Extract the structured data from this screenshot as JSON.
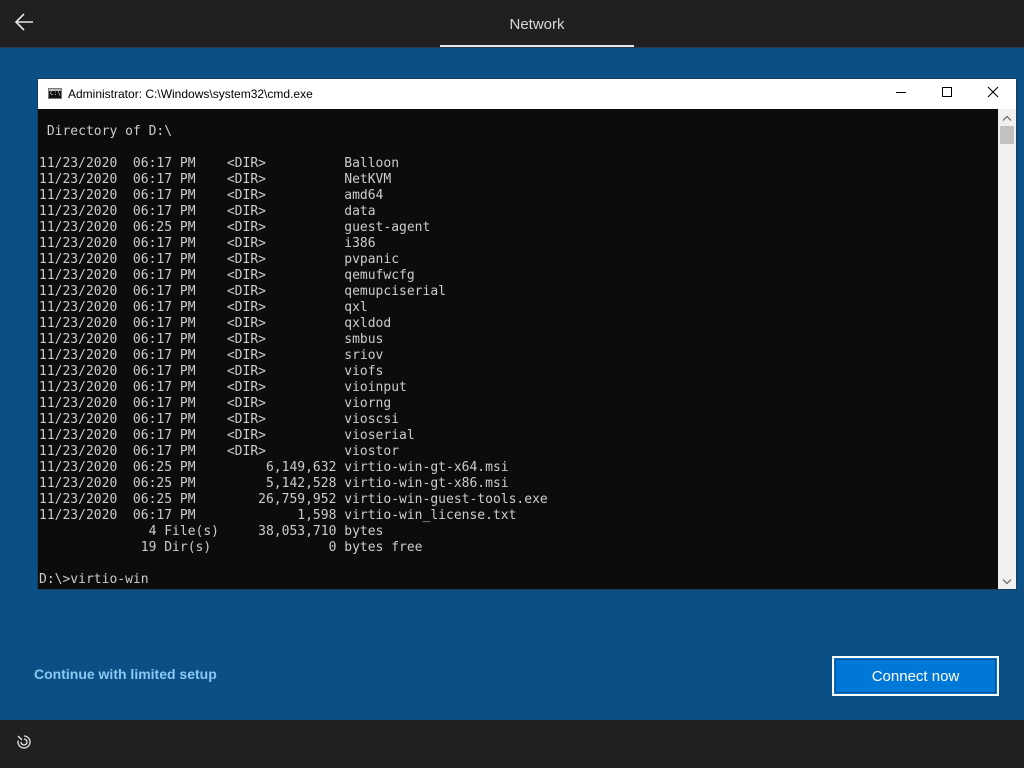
{
  "header": {
    "title": "Network",
    "back_icon": "arrow-left-icon"
  },
  "cmd_window": {
    "title": "Administrator: C:\\Windows\\system32\\cmd.exe",
    "icons": {
      "app": "cmd-app-icon",
      "minimize": "minimize-icon",
      "maximize": "maximize-icon",
      "close": "close-icon"
    },
    "console_lines": [
      " Directory of D:\\",
      "",
      "11/23/2020  06:17 PM    <DIR>          Balloon",
      "11/23/2020  06:17 PM    <DIR>          NetKVM",
      "11/23/2020  06:17 PM    <DIR>          amd64",
      "11/23/2020  06:17 PM    <DIR>          data",
      "11/23/2020  06:25 PM    <DIR>          guest-agent",
      "11/23/2020  06:17 PM    <DIR>          i386",
      "11/23/2020  06:17 PM    <DIR>          pvpanic",
      "11/23/2020  06:17 PM    <DIR>          qemufwcfg",
      "11/23/2020  06:17 PM    <DIR>          qemupciserial",
      "11/23/2020  06:17 PM    <DIR>          qxl",
      "11/23/2020  06:17 PM    <DIR>          qxldod",
      "11/23/2020  06:17 PM    <DIR>          smbus",
      "11/23/2020  06:17 PM    <DIR>          sriov",
      "11/23/2020  06:17 PM    <DIR>          viofs",
      "11/23/2020  06:17 PM    <DIR>          vioinput",
      "11/23/2020  06:17 PM    <DIR>          viorng",
      "11/23/2020  06:17 PM    <DIR>          vioscsi",
      "11/23/2020  06:17 PM    <DIR>          vioserial",
      "11/23/2020  06:17 PM    <DIR>          viostor",
      "11/23/2020  06:25 PM         6,149,632 virtio-win-gt-x64.msi",
      "11/23/2020  06:25 PM         5,142,528 virtio-win-gt-x86.msi",
      "11/23/2020  06:25 PM        26,759,952 virtio-win-guest-tools.exe",
      "11/23/2020  06:17 PM             1,598 virtio-win_license.txt",
      "              4 File(s)     38,053,710 bytes",
      "             19 Dir(s)               0 bytes free",
      "",
      "D:\\>virtio-win"
    ]
  },
  "footer": {
    "limited_setup_label": "Continue with limited setup",
    "connect_label": "Connect now",
    "ease_icon": "ease-of-access-icon"
  },
  "colors": {
    "background": "#0a4f86",
    "bar": "#202020",
    "accent": "#0078d7",
    "link": "#8ac9f2",
    "console_bg": "#0c0c0c",
    "console_text": "#cccccc"
  }
}
